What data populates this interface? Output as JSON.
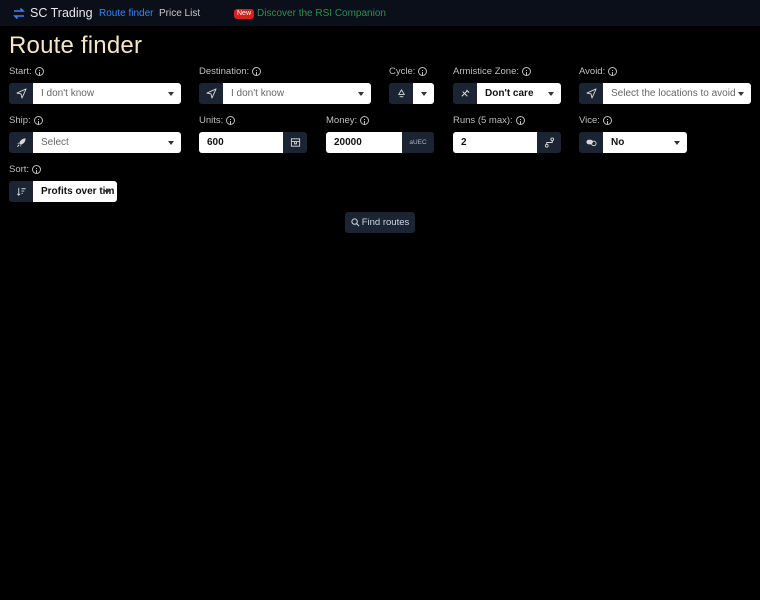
{
  "navbar": {
    "brand": "SC Trading",
    "links": [
      "Route finder",
      "Price List"
    ],
    "promo_badge": "New",
    "promo_text": "Discover the RSI Companion"
  },
  "page_title": "Route finder",
  "fields": {
    "start": {
      "label": "Start:",
      "value": "I don't know",
      "icon": "navigation-arrow-icon"
    },
    "destination": {
      "label": "Destination:",
      "value": "I don't know",
      "icon": "navigation-arrow-icon"
    },
    "cycle": {
      "label": "Cycle:",
      "icon": "recycle-icon"
    },
    "armistice": {
      "label": "Armistice Zone:",
      "value": "Don't care",
      "icon": "no-weapon-icon"
    },
    "avoid": {
      "label": "Avoid:",
      "placeholder": "Select the locations to avoid",
      "icon": "navigation-arrow-icon"
    },
    "ship": {
      "label": "Ship:",
      "value": "Select",
      "icon": "rocket-icon"
    },
    "units": {
      "label": "Units:",
      "value": "600",
      "icon": "cargo-box-icon"
    },
    "money": {
      "label": "Money:",
      "value": "20000",
      "suffix": "aUEC"
    },
    "runs": {
      "label": "Runs (5 max):",
      "value": "2",
      "icon": "route-icon"
    },
    "vice": {
      "label": "Vice:",
      "value": "No",
      "icon": "pills-icon"
    },
    "sort": {
      "label": "Sort:",
      "value": "Profits over tim",
      "icon": "sort-icon"
    }
  },
  "find_button": {
    "label": "Find routes",
    "icon": "search-icon"
  },
  "colors": {
    "background": "#000000",
    "addon": "#1b2432",
    "accent": "#3b82f6",
    "title": "#f5e6c8",
    "promo": "#2f8f4f"
  }
}
